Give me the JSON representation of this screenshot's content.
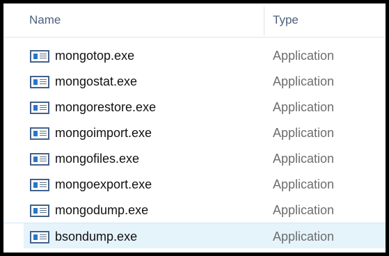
{
  "columns": {
    "name": "Name",
    "type": "Type"
  },
  "files": [
    {
      "name": "mongotop.exe",
      "type": "Application",
      "icon": "application-exe-icon",
      "selected": false
    },
    {
      "name": "mongostat.exe",
      "type": "Application",
      "icon": "application-exe-icon",
      "selected": false
    },
    {
      "name": "mongorestore.exe",
      "type": "Application",
      "icon": "application-exe-icon",
      "selected": false
    },
    {
      "name": "mongoimport.exe",
      "type": "Application",
      "icon": "application-exe-icon",
      "selected": false
    },
    {
      "name": "mongofiles.exe",
      "type": "Application",
      "icon": "application-exe-icon",
      "selected": false
    },
    {
      "name": "mongoexport.exe",
      "type": "Application",
      "icon": "application-exe-icon",
      "selected": false
    },
    {
      "name": "mongodump.exe",
      "type": "Application",
      "icon": "application-exe-icon",
      "selected": false
    },
    {
      "name": "bsondump.exe",
      "type": "Application",
      "icon": "application-exe-icon",
      "selected": true
    }
  ],
  "colors": {
    "header_text": "#4c607a",
    "name_text": "#111111",
    "type_text": "#6d6d6d",
    "selected_row": "#e5f3fb",
    "icon_accent": "#2677c9"
  }
}
